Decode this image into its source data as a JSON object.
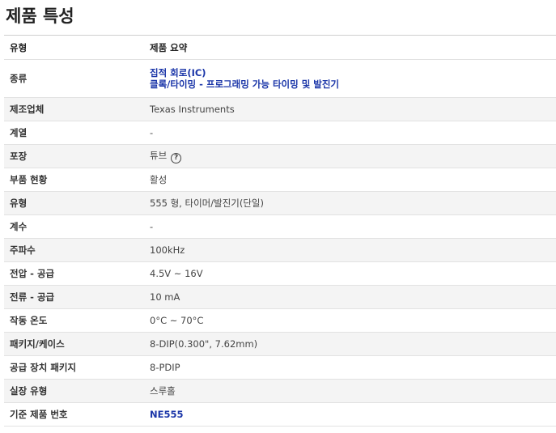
{
  "title": "제품 특성",
  "header": {
    "label": "유형",
    "value": "제품 요약"
  },
  "rows": [
    {
      "label": "종류",
      "lines": [
        "집적 회로(IC)",
        "클록/타이밍 - 프로그래밍 가능 타이밍 및 발진기"
      ],
      "link": true
    },
    {
      "label": "제조업체",
      "value": "Texas Instruments"
    },
    {
      "label": "계열",
      "value": "-"
    },
    {
      "label": "포장",
      "value": "튜브",
      "help_icon": "question-circle-icon"
    },
    {
      "label": "부품 현황",
      "value": "활성"
    },
    {
      "label": "유형",
      "value": "555 형, 타이머/발진기(단일)"
    },
    {
      "label": "계수",
      "value": "-"
    },
    {
      "label": "주파수",
      "value": "100kHz"
    },
    {
      "label": "전압 - 공급",
      "value": "4.5V ~ 16V"
    },
    {
      "label": "전류 - 공급",
      "value": "10 mA"
    },
    {
      "label": "작동 온도",
      "value": "0°C ~ 70°C"
    },
    {
      "label": "패키지/케이스",
      "value": "8-DIP(0.300\", 7.62mm)"
    },
    {
      "label": "공급 장치 패키지",
      "value": "8-PDIP"
    },
    {
      "label": "실장 유형",
      "value": "스루홀"
    },
    {
      "label": "기준 제품 번호",
      "value": "NE555",
      "link": true
    }
  ],
  "colors": {
    "link": "#1a35a8",
    "alt_row": "#f4f4f4",
    "border": "#e2e2e2"
  }
}
